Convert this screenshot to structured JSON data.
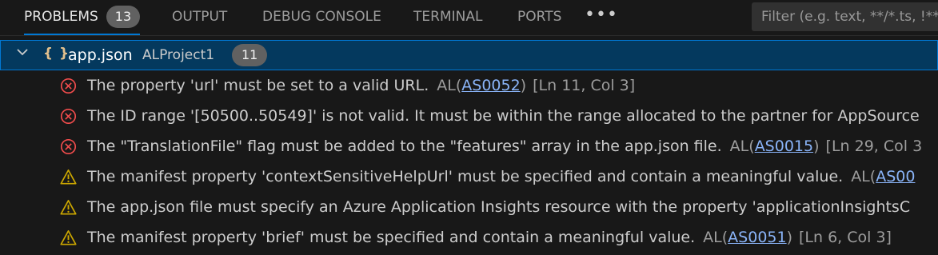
{
  "tabs": [
    {
      "label": "PROBLEMS",
      "badge": "13",
      "active": true
    },
    {
      "label": "OUTPUT"
    },
    {
      "label": "DEBUG CONSOLE"
    },
    {
      "label": "TERMINAL"
    },
    {
      "label": "PORTS"
    }
  ],
  "more_label": "•••",
  "filter": {
    "placeholder": "Filter (e.g. text, **/*.ts, !**"
  },
  "group": {
    "file": "app.json",
    "project": "ALProject1",
    "count": "11",
    "icon": "json-braces-icon"
  },
  "problems": [
    {
      "severity": "error",
      "message": "The property 'url' must be set to a valid URL.",
      "source": "AL",
      "code": "AS0052",
      "location": "[Ln 11, Col 3]"
    },
    {
      "severity": "error",
      "message": "The ID range '[50500..50549]' is not valid. It must be within the range allocated to the partner for AppSource",
      "source": "",
      "code": "",
      "location": ""
    },
    {
      "severity": "error",
      "message": "The \"TranslationFile\" flag must be added to the \"features\" array in the app.json file.",
      "source": "AL",
      "code": "AS0015",
      "location": "[Ln 29, Col 3"
    },
    {
      "severity": "warning",
      "message": "The manifest property 'contextSensitiveHelpUrl' must be specified and contain a meaningful value.",
      "source": "AL",
      "code": "AS00",
      "location": ""
    },
    {
      "severity": "warning",
      "message": "The app.json file must specify an Azure Application Insights resource with the property 'applicationInsightsC",
      "source": "",
      "code": "",
      "location": ""
    },
    {
      "severity": "warning",
      "message": "The manifest property 'brief' must be specified and contain a meaningful value.",
      "source": "AL",
      "code": "AS0051",
      "location": "[Ln 6, Col 3]"
    }
  ],
  "colors": {
    "error": "#f14c4c",
    "warning": "#cca700",
    "accent": "#0078d4"
  }
}
